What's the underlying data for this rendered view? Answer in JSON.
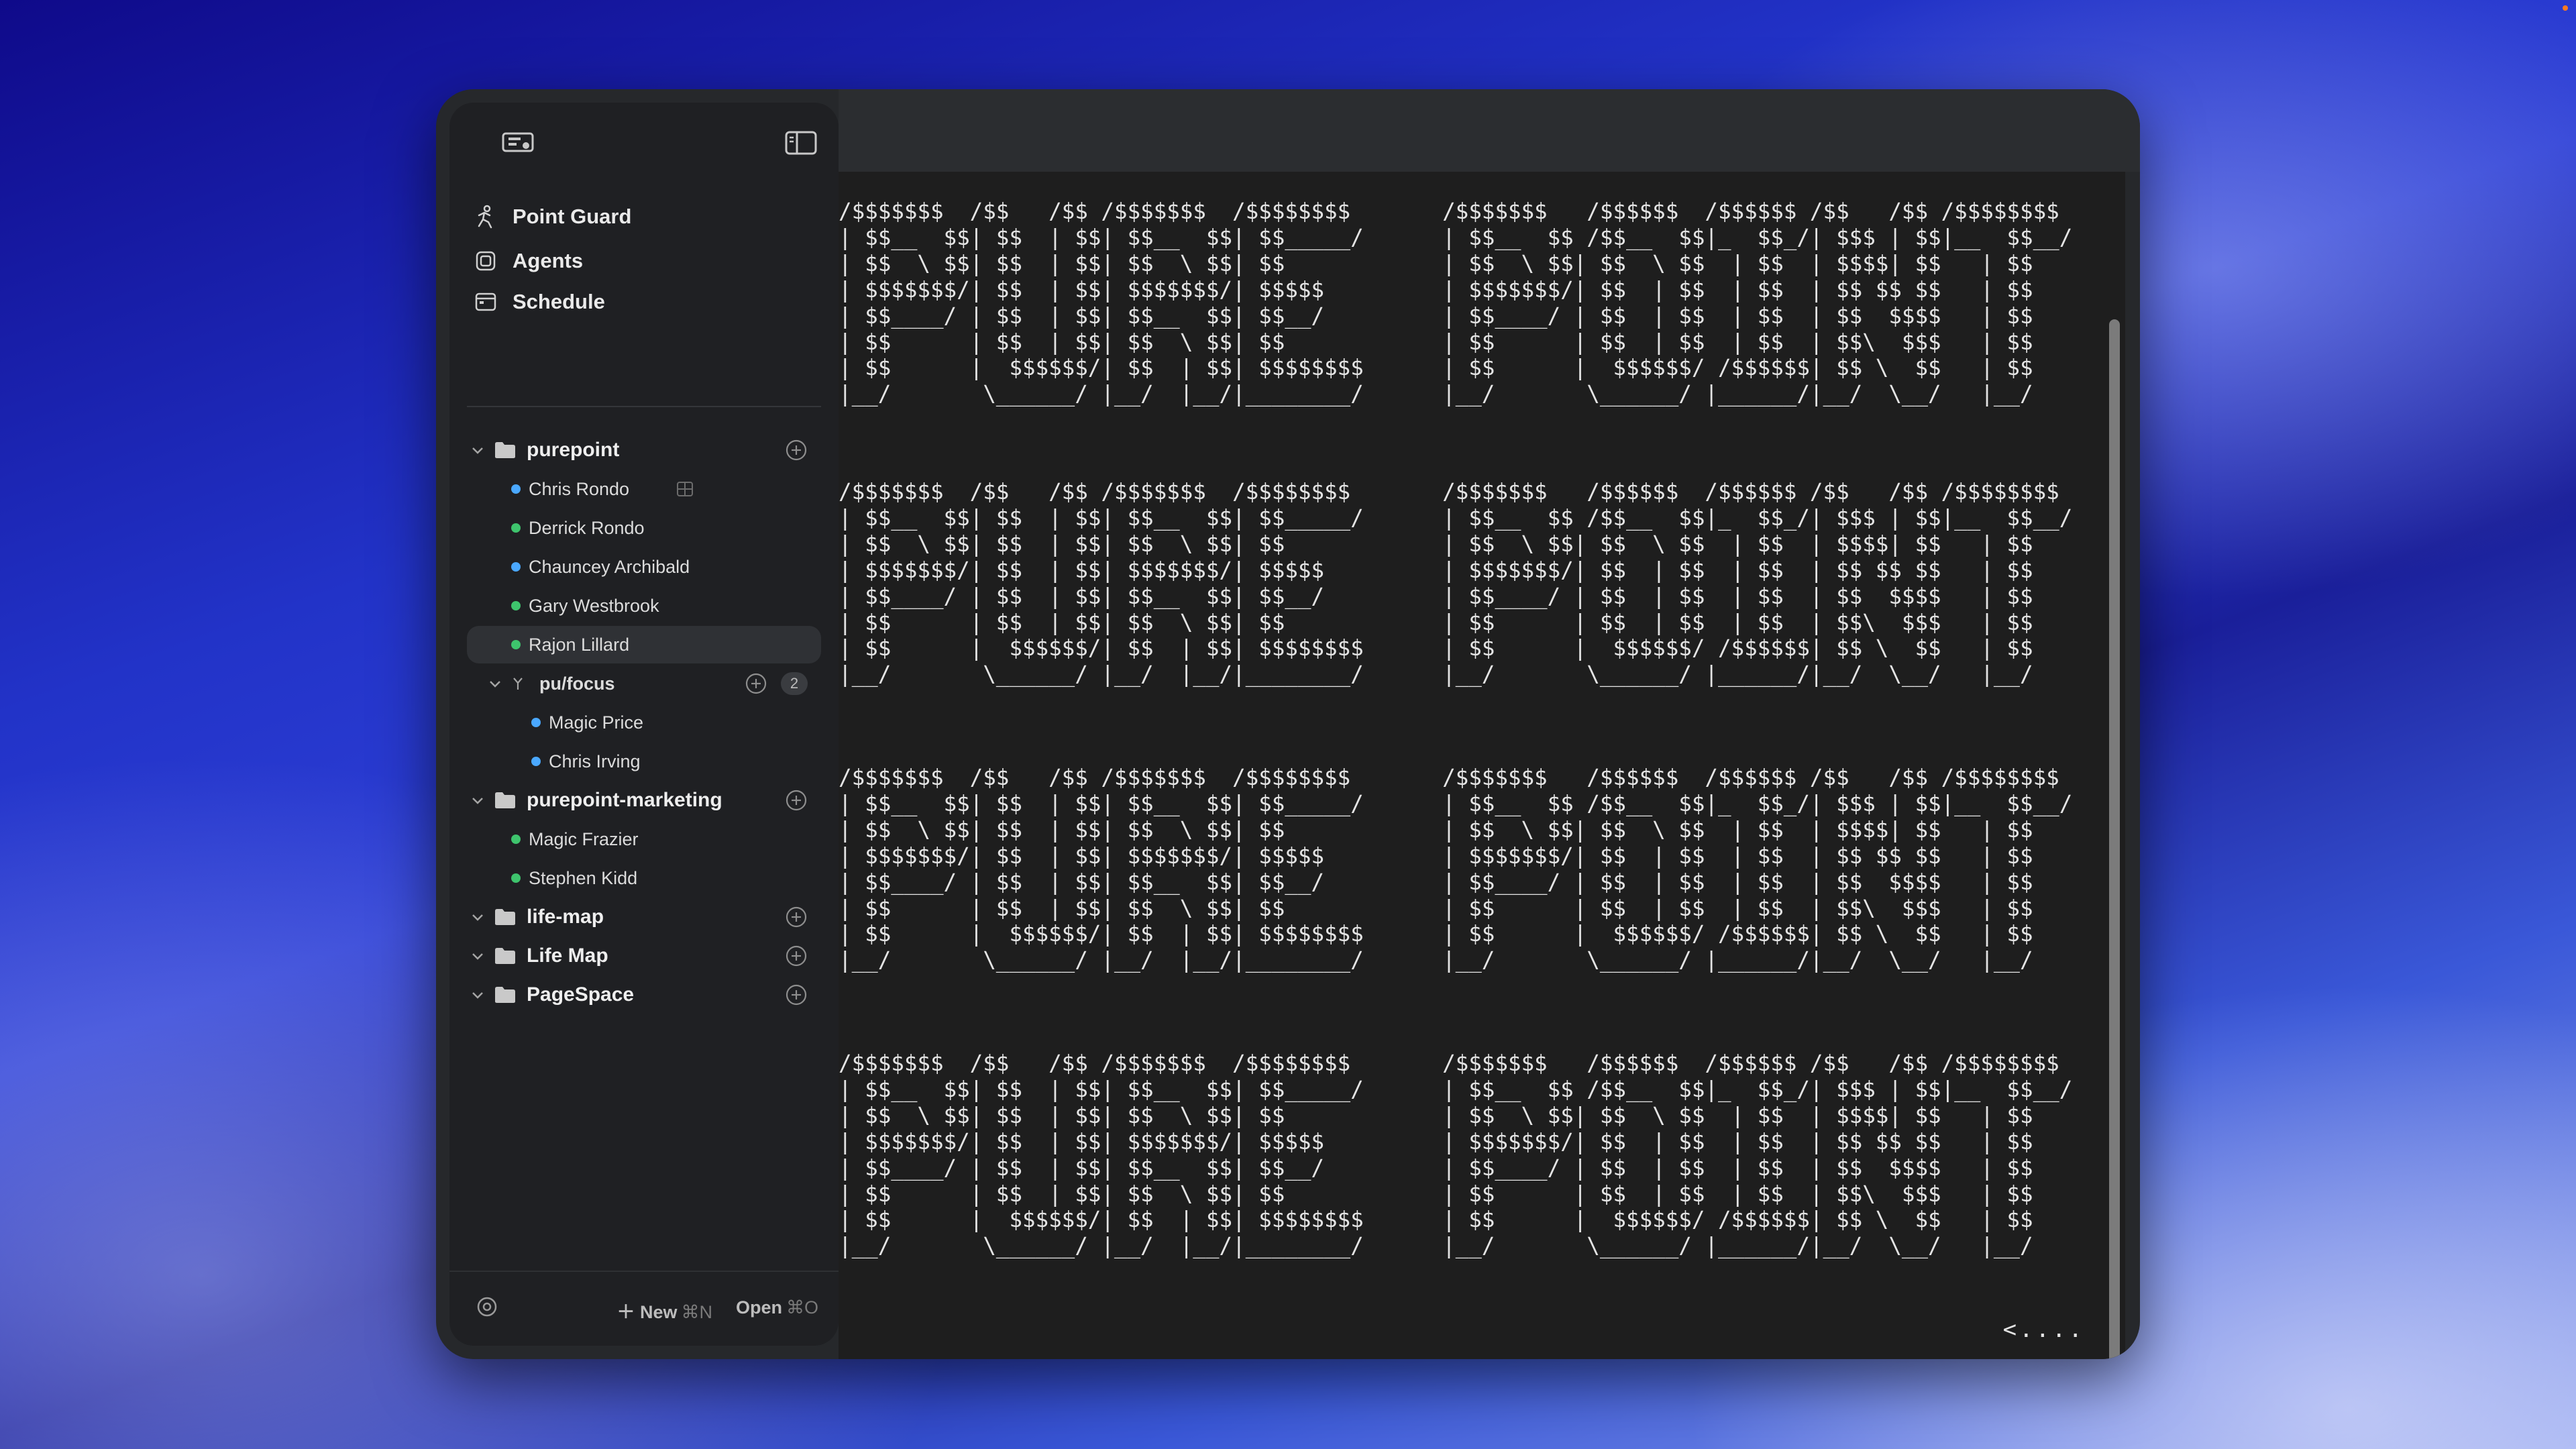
{
  "sidebar": {
    "nav": [
      {
        "label": "Point Guard",
        "icon": "person-run-icon"
      },
      {
        "label": "Agents",
        "icon": "agents-icon"
      },
      {
        "label": "Schedule",
        "icon": "calendar-icon"
      }
    ],
    "projects": [
      {
        "name": "purepoint",
        "agents": [
          {
            "name": "Chris Rondo",
            "status_color": "#4aa8ff"
          },
          {
            "name": "Derrick Rondo",
            "status_color": "#3ec46d"
          },
          {
            "name": "Chauncey Archibald",
            "status_color": "#4aa8ff"
          },
          {
            "name": "Gary Westbrook",
            "status_color": "#3ec46d"
          },
          {
            "name": "Rajon Lillard",
            "status_color": "#3ec46d"
          }
        ],
        "branch": {
          "name": "pu/focus",
          "count": "2",
          "agents": [
            {
              "name": "Magic Price",
              "status_color": "#4aa8ff"
            },
            {
              "name": "Chris Irving",
              "status_color": "#4aa8ff"
            }
          ]
        }
      },
      {
        "name": "purepoint-marketing",
        "agents": [
          {
            "name": "Magic Frazier",
            "status_color": "#3ec46d"
          },
          {
            "name": "Stephen Kidd",
            "status_color": "#3ec46d"
          }
        ]
      },
      {
        "name": "life-map",
        "agents": []
      },
      {
        "name": "Life Map",
        "agents": []
      },
      {
        "name": "PageSpace",
        "agents": []
      }
    ],
    "footer": {
      "new_label": "New",
      "new_shortcut": "⌘N",
      "open_label": "Open",
      "open_shortcut": "⌘O"
    }
  },
  "terminal": {
    "ascii_art": "/$$$$$$$  /$$   /$$ /$$$$$$$  /$$$$$$$$       /$$$$$$$   /$$$$$$  /$$$$$$ /$$   /$$ /$$$$$$$$\n| $$__  $$| $$  | $$| $$__  $$| $$_____/      | $$__  $$ /$$__  $$|_  $$_/| $$$ | $$|__  $$__/\n| $$  \\ $$| $$  | $$| $$  \\ $$| $$            | $$  \\ $$| $$  \\ $$  | $$  | $$$$| $$   | $$\n| $$$$$$$/| $$  | $$| $$$$$$$/| $$$$$         | $$$$$$$/| $$  | $$  | $$  | $$ $$ $$   | $$\n| $$____/ | $$  | $$| $$__  $$| $$__/         | $$____/ | $$  | $$  | $$  | $$  $$$$   | $$\n| $$      | $$  | $$| $$  \\ $$| $$            | $$      | $$  | $$  | $$  | $$\\  $$$   | $$\n| $$      |  $$$$$$/| $$  | $$| $$$$$$$$      | $$      |  $$$$$$/ /$$$$$$| $$ \\  $$   | $$\n|__/       \\______/ |__/  |__/|________/      |__/       \\______/ |______/|__/  \\__/   |__/",
    "prompt": "<...."
  }
}
